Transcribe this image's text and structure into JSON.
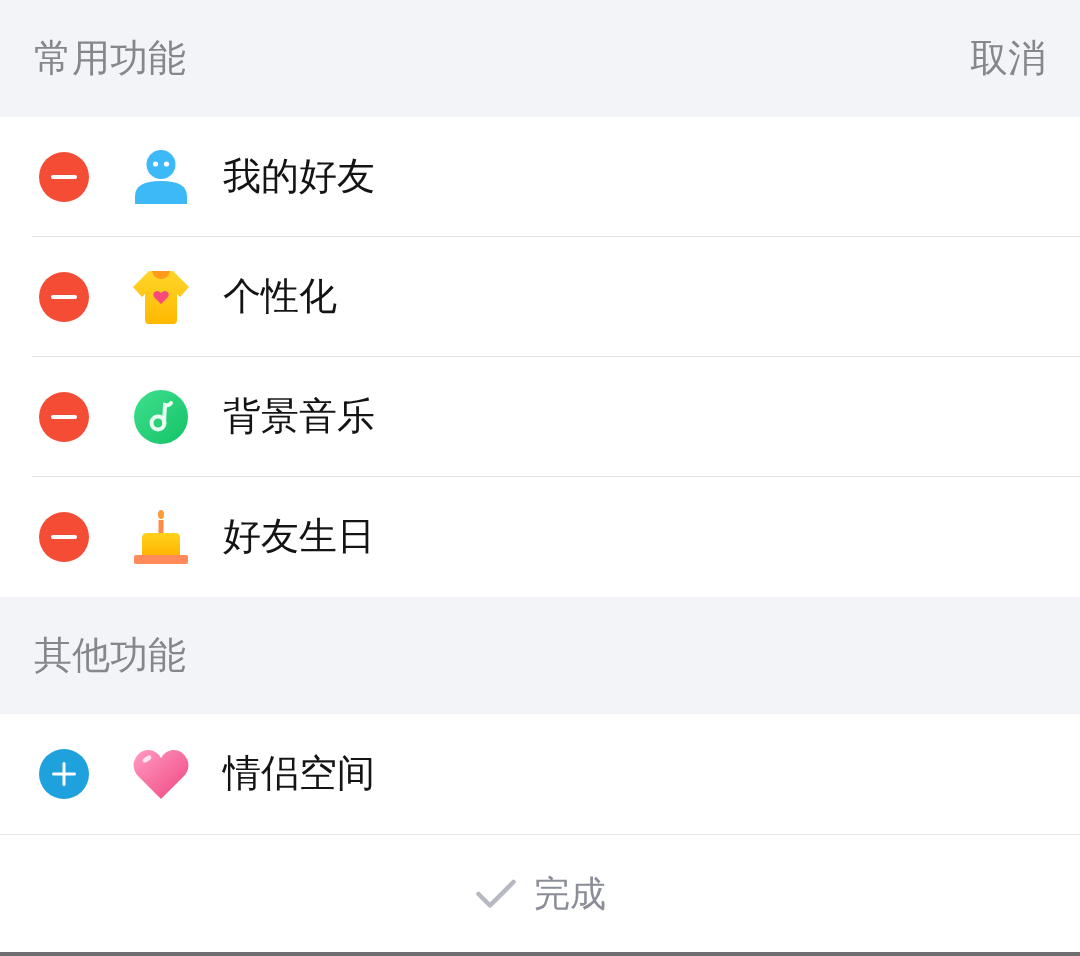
{
  "sections": [
    {
      "title": "常用功能",
      "action": "取消",
      "items": [
        {
          "label": "我的好友",
          "kind": "remove"
        },
        {
          "label": "个性化",
          "kind": "remove"
        },
        {
          "label": "背景音乐",
          "kind": "remove"
        },
        {
          "label": "好友生日",
          "kind": "remove"
        }
      ]
    },
    {
      "title": "其他功能",
      "items": [
        {
          "label": "情侣空间",
          "kind": "add"
        }
      ]
    }
  ],
  "footer": {
    "label": "完成"
  }
}
